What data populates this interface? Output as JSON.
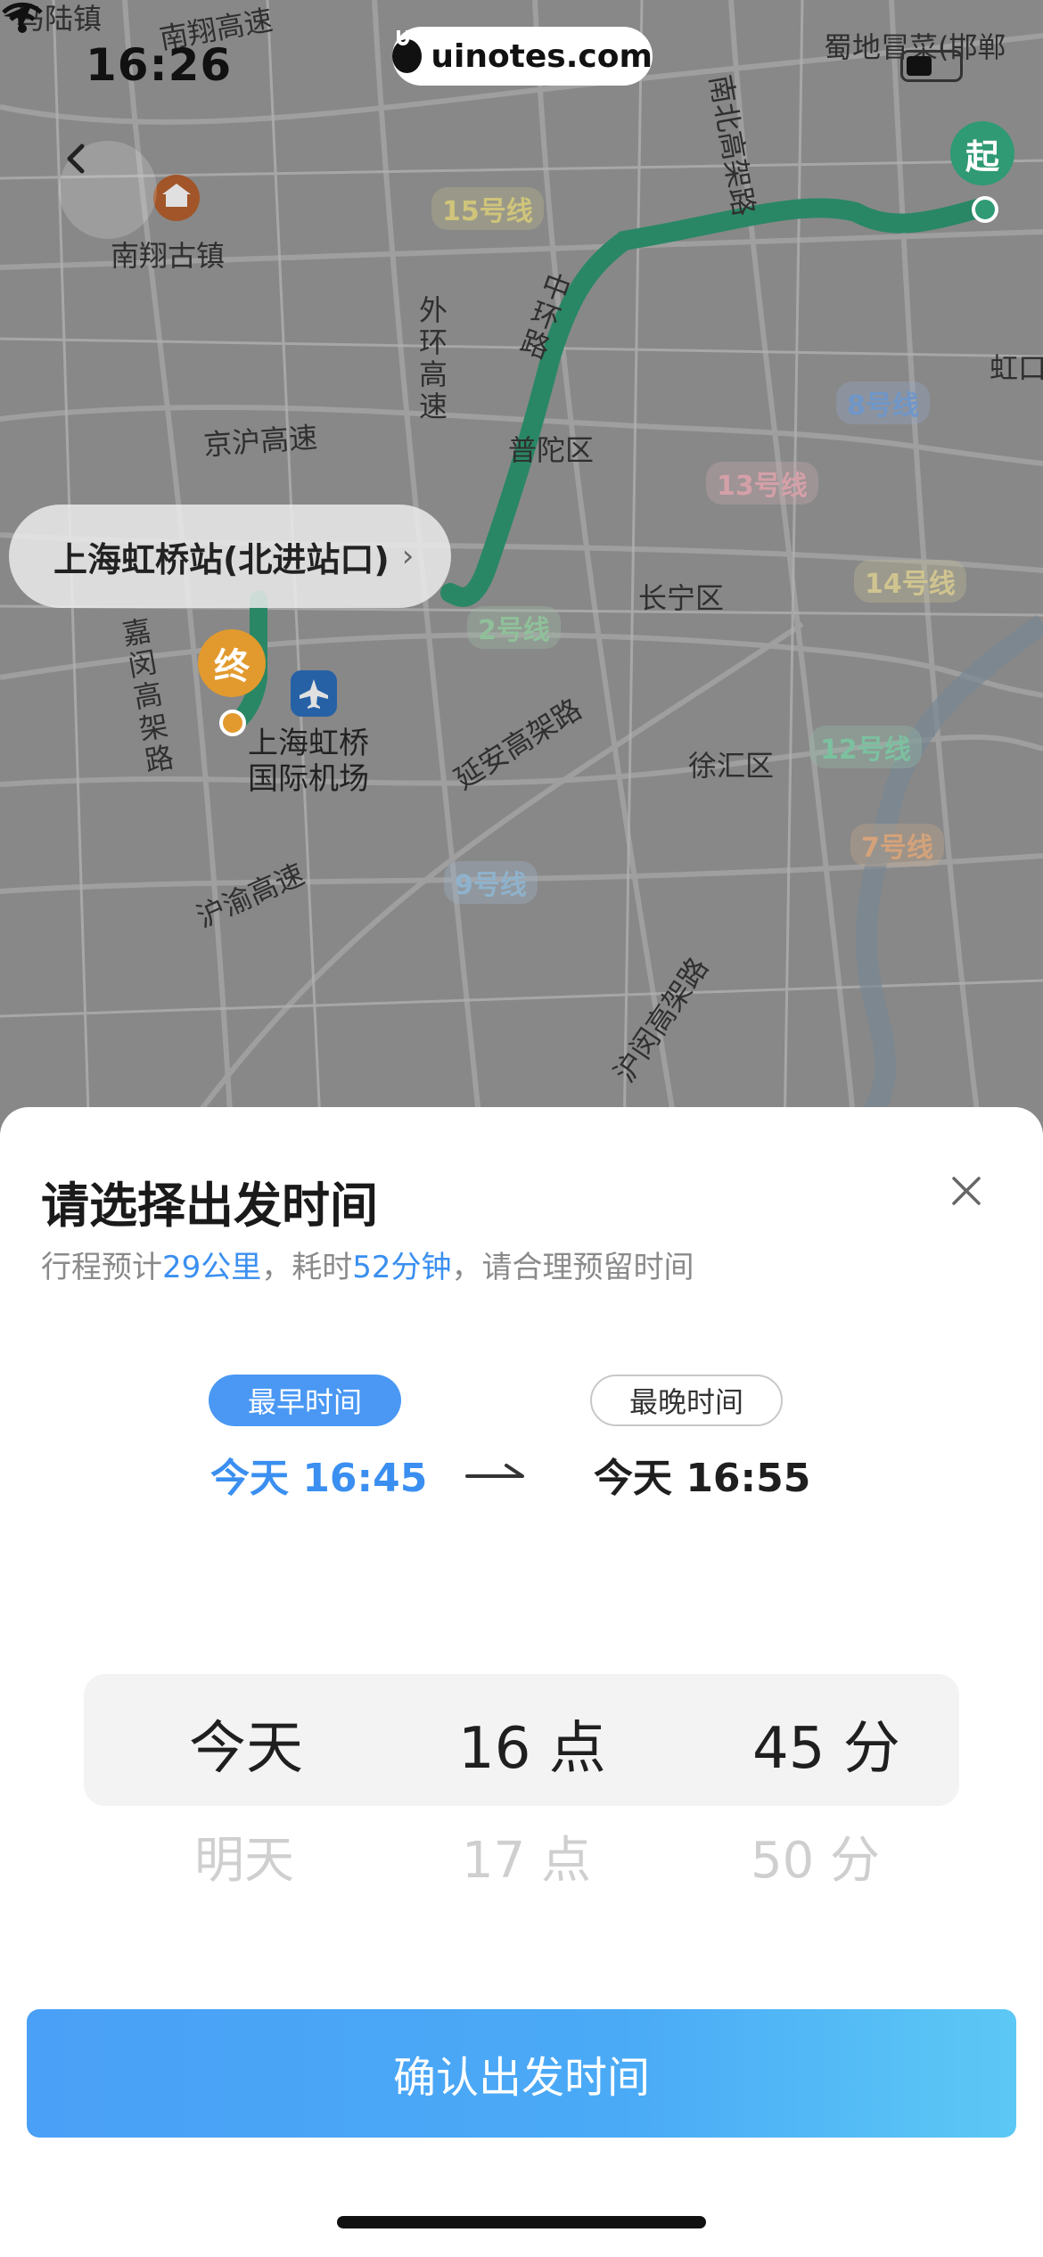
{
  "status_bar": {
    "time": "16:26"
  },
  "watermark": {
    "text": "uinotes.com"
  },
  "map": {
    "start_marker": "起",
    "end_marker": "终",
    "station_pill": {
      "label": "上海虹桥站(北进站口)",
      "chevron": "›"
    },
    "labels": {
      "malu": "马陆镇",
      "nanxiang_gaosu": "南翔高速",
      "nanbei_gaojia": "南北高架路",
      "shudi": "蜀地冒菜(邯郸",
      "nanxiang_guzhen": "南翔古镇",
      "waihuan": "外环高速",
      "zhongshan": "中环路",
      "hongkou": "虹口",
      "jinghu": "京沪高速",
      "putuo": "普陀区",
      "changning": "长宁区",
      "jiamin": "嘉闵高架路",
      "hongqiao_airport": "上海虹桥国际机场",
      "yanan": "延安高架路",
      "xuhui": "徐汇区",
      "huyu": "沪渝高速",
      "humin": "沪闵高架路"
    },
    "metro": {
      "l15": "15号线",
      "l8": "8号线",
      "l13": "13号线",
      "l14": "14号线",
      "l2": "2号线",
      "l12": "12号线",
      "l7": "7号线",
      "l9": "9号线"
    }
  },
  "sheet": {
    "title": "请选择出发时间",
    "subtitle": {
      "p1": "行程预计",
      "distance": "29公里",
      "p2": "，耗时",
      "duration": "52分钟",
      "p3": "，请合理预留时间"
    },
    "earliest": {
      "tag": "最早时间",
      "value": "今天 16:45"
    },
    "latest": {
      "tag": "最晚时间",
      "value": "今天 16:55"
    },
    "picker": {
      "day": {
        "selected": "今天",
        "next": "明天"
      },
      "hour": {
        "selected": "16 点",
        "next": "17 点"
      },
      "minute": {
        "selected": "45 分",
        "next": "50 分"
      }
    },
    "confirm_label": "确认出发时间"
  },
  "colors": {
    "accent": "#3a8ff0",
    "route": "#2f9a74",
    "start_marker": "#2f9a74",
    "end_marker": "#e29a2e"
  }
}
